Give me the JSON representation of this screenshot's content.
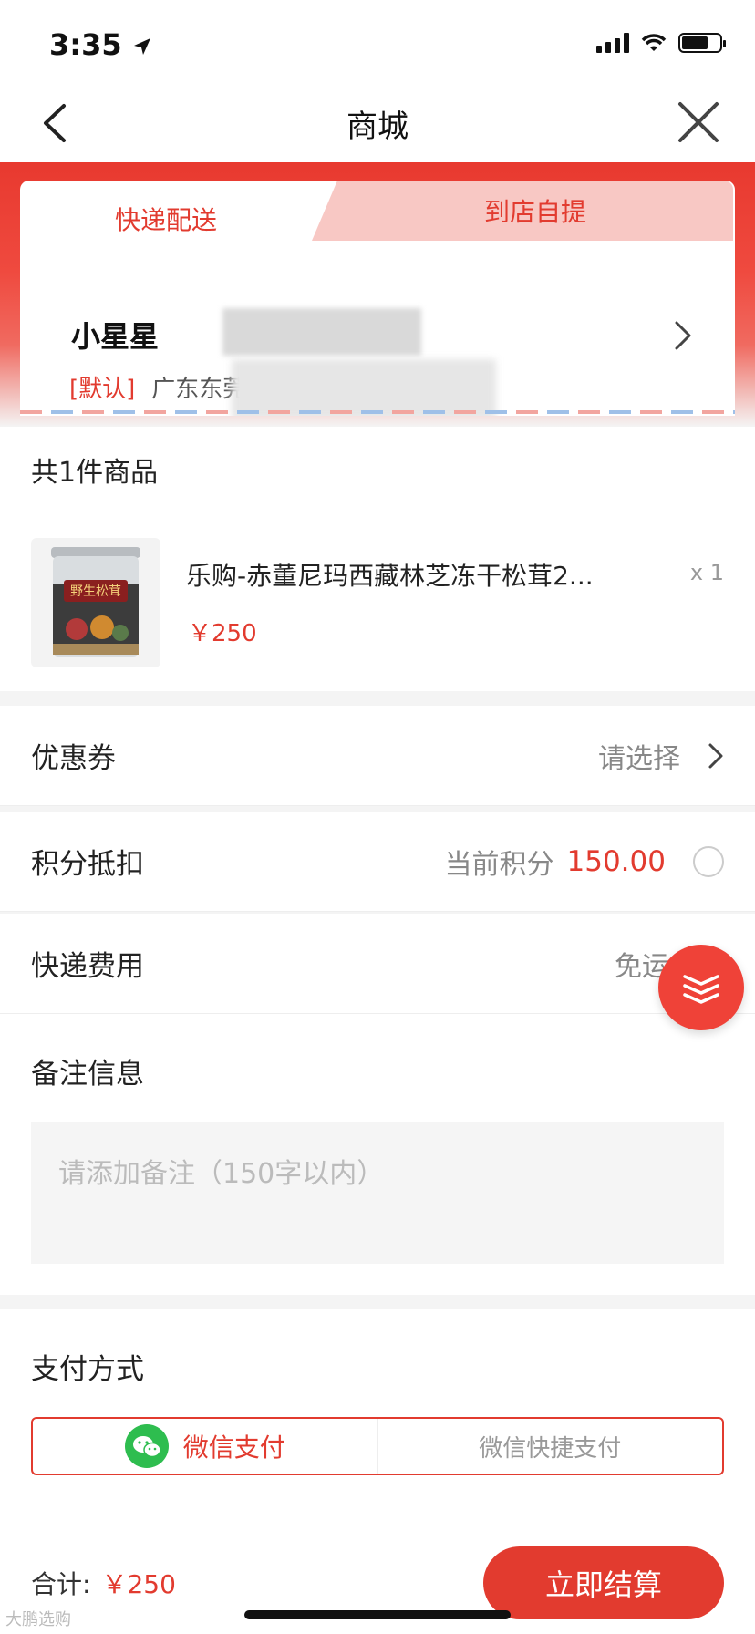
{
  "status_bar": {
    "time": "3:35"
  },
  "nav": {
    "title": "商城"
  },
  "delivery": {
    "tab_active": "快递配送",
    "tab_inactive": "到店自提",
    "recipient_name": "小星星",
    "default_tag": "[默认]",
    "address_prefix": "广东东莞"
  },
  "goods": {
    "header": "共1件商品",
    "item": {
      "name": "乐购-赤董尼玛西藏林芝冻干松茸2...",
      "price": "￥250",
      "quantity": "x 1",
      "thumb_label": "野生松茸"
    }
  },
  "coupon": {
    "label": "优惠券",
    "value": "请选择"
  },
  "points": {
    "label": "积分抵扣",
    "prefix": "当前积分",
    "value": "150.00"
  },
  "shipping": {
    "label": "快递费用",
    "value": "免运"
  },
  "remark": {
    "label": "备注信息",
    "placeholder": "请添加备注（150字以内）"
  },
  "payment": {
    "label": "支付方式",
    "option_active": "微信支付",
    "option_inactive": "微信快捷支付"
  },
  "footer": {
    "total_label": "合计:",
    "total_amount": "￥250",
    "checkout_label": "立即结算",
    "watermark": "大鹏选购"
  },
  "colors": {
    "accent": "#e23b2f",
    "wechat": "#2ebd4f"
  }
}
